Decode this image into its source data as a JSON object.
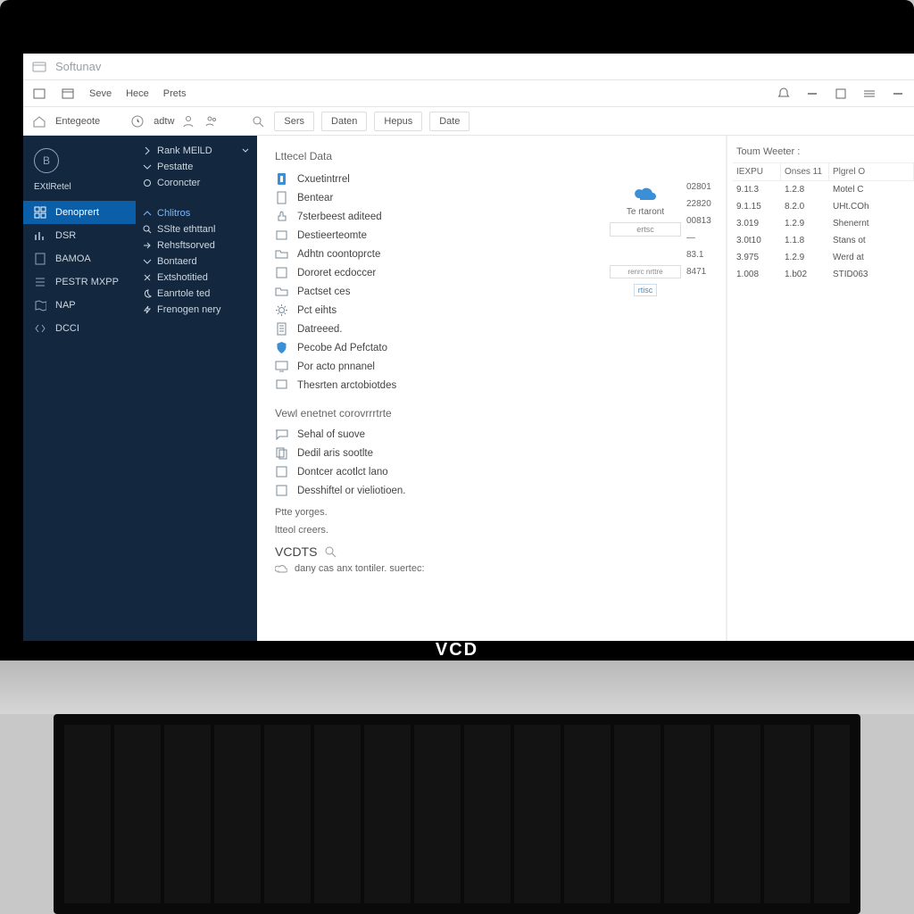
{
  "brand": "VCD",
  "titlebar": {
    "app": "Softunav"
  },
  "toolbar1": {
    "items": [
      "Seve",
      "Hece",
      "Prets"
    ]
  },
  "toolbar2": {
    "left": [
      "Entegeote",
      "adtw"
    ],
    "tabs": [
      "Sers",
      "Daten",
      "Hepus",
      "Date"
    ]
  },
  "sidebar": {
    "org": "EXtlRetel",
    "nav": [
      {
        "label": "Denoprert",
        "sel": true
      },
      {
        "label": "DSR"
      },
      {
        "label": "BAMOA"
      },
      {
        "label": "PESTR MXPP"
      },
      {
        "label": "NAP"
      },
      {
        "label": "DCCI"
      }
    ],
    "tree": [
      {
        "label": "Rank MElLD",
        "chev": "right",
        "top": true
      },
      {
        "label": "Pestatte",
        "chev": "down"
      },
      {
        "label": "Coroncter",
        "bullet": true
      },
      {
        "label": "Chlitros",
        "chev": "up",
        "blue": true
      },
      {
        "label": "SSlte ethttanl",
        "search": true
      },
      {
        "label": "Rehsftsorved",
        "chev": "fwd"
      },
      {
        "label": "Bontaerd",
        "chev": "down"
      },
      {
        "label": "Extshotitied",
        "close": true
      },
      {
        "label": "Eanrtole ted",
        "moon": true
      },
      {
        "label": "Frenogen nery",
        "bolt": true
      }
    ]
  },
  "content": {
    "heading1": "Lttecel Data",
    "list1": [
      "Cxuetintrrel",
      "Bentear",
      "7sterbeest aditeed",
      "Destieerteomte",
      "Adhtn coontoprcte",
      "Dororet ecdoccer",
      "Pactset ces",
      "Pct eihts",
      "Datreeed.",
      "Pecobe Ad Pefctato",
      "Por acto pnnanel",
      "Thesrten arctobiotdes"
    ],
    "heading2": "Vewl enetnet corovrrrtrte",
    "list2": [
      "Sehal of suove",
      "Dedil aris sootlte",
      "Dontcer acotlct lano",
      "Desshiftel or vieliotioen."
    ],
    "kv": [
      "Ptte yorges.",
      "ltteol creers."
    ],
    "vcdts": "VCDTS",
    "note": "dany cas anx tontiler. suertec:"
  },
  "midcol": {
    "label": "Te rtaront",
    "rows": [
      "02801",
      "22820",
      "00813",
      "—",
      "83.1",
      "8471"
    ],
    "tag": "rtisc",
    "b1": "ertsc",
    "b2": "renrc nrttre"
  },
  "rpanel": {
    "title": "Toum Weeter :",
    "head": [
      "IEXPU",
      "Onses 11",
      "Plgrel O"
    ],
    "rows": [
      [
        "9.1t.3",
        "1.2.8",
        "Motel C"
      ],
      [
        "9.1.15",
        "8.2.0",
        "UHt.COh"
      ],
      [
        "3.019",
        "1.2.9",
        "Shenernt"
      ],
      [
        "3.0t10",
        "1.1.8",
        "Stans ot"
      ],
      [
        "3.975",
        "1.2.9",
        "Werd at"
      ],
      [
        "1.008",
        "1.b02",
        "STID063"
      ]
    ]
  }
}
